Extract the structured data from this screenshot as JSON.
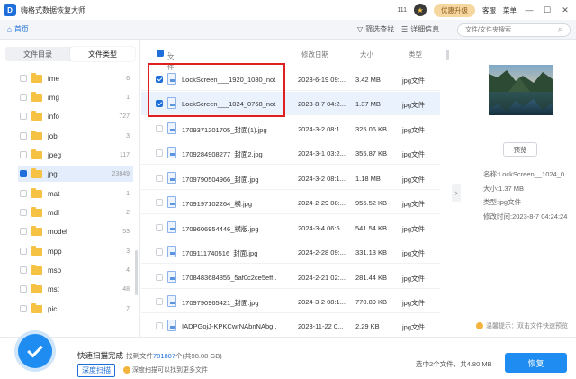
{
  "app": {
    "title": "嗨格式数据恢复大师",
    "logo": "D",
    "coins": "111",
    "vip_label": "优惠升级",
    "service": "客服",
    "menu": "菜单"
  },
  "toolbar": {
    "home": "首页",
    "filter": "筛选查找",
    "detail": "详细信息",
    "search_placeholder": "文件/文件夹搜索"
  },
  "sidebar": {
    "tabs": [
      "文件目录",
      "文件类型"
    ],
    "folders": [
      {
        "name": "ime",
        "count": "6"
      },
      {
        "name": "img",
        "count": "1"
      },
      {
        "name": "info",
        "count": "727"
      },
      {
        "name": "job",
        "count": "3"
      },
      {
        "name": "jpeg",
        "count": "117"
      },
      {
        "name": "jpg",
        "count": "23849"
      },
      {
        "name": "mat",
        "count": "1"
      },
      {
        "name": "mdl",
        "count": "2"
      },
      {
        "name": "model",
        "count": "53"
      },
      {
        "name": "mpp",
        "count": "3"
      },
      {
        "name": "msp",
        "count": "4"
      },
      {
        "name": "mst",
        "count": "48"
      },
      {
        "name": "pic",
        "count": "7"
      }
    ]
  },
  "list": {
    "headers": {
      "name": "文件名",
      "date": "修改日期",
      "size": "大小",
      "type": "类型"
    },
    "rows": [
      {
        "name": "LockScreen___1920_1080_not...",
        "date": "2023-6-19 09:...",
        "size": "3.42 MB",
        "type": "jpg文件"
      },
      {
        "name": "LockScreen___1024_0768_not...",
        "date": "2023-8-7 04:2...",
        "size": "1.37 MB",
        "type": "jpg文件"
      },
      {
        "name": "1709371201705_封面(1).jpg",
        "date": "2024-3-2 08:1...",
        "size": "325.06 KB",
        "type": "jpg文件"
      },
      {
        "name": "1709284908277_封面2.jpg",
        "date": "2024-3-1 03:2...",
        "size": "355.87 KB",
        "type": "jpg文件"
      },
      {
        "name": "1709790504966_封面.jpg",
        "date": "2024-3-2 08:1...",
        "size": "1.18 MB",
        "type": "jpg文件"
      },
      {
        "name": "1709197102264_横.jpg",
        "date": "2024-2-29 08:...",
        "size": "955.52 KB",
        "type": "jpg文件"
      },
      {
        "name": "1709606954446_横版.jpg",
        "date": "2024-3-4 06:5...",
        "size": "541.54 KB",
        "type": "jpg文件"
      },
      {
        "name": "1709111740516_封面.jpg",
        "date": "2024-2-28 09:...",
        "size": "331.13 KB",
        "type": "jpg文件"
      },
      {
        "name": "1708483684855_5af0c2ce5eff...",
        "date": "2024-2-21 02:...",
        "size": "281.44 KB",
        "type": "jpg文件"
      },
      {
        "name": "1709790965421_封面.jpg",
        "date": "2024-3-2 08:1...",
        "size": "770.89 KB",
        "type": "jpg文件"
      },
      {
        "name": "IADPGojJ-KPKCwrNAbnNAbg...",
        "date": "2023-11-22 0...",
        "size": "2.29 KB",
        "type": "jpg文件"
      }
    ]
  },
  "details": {
    "preview_button": "预览",
    "name": "名称:LockScreen__1024_0...",
    "size": "大小:1.37 MB",
    "type": "类型:jpg文件",
    "modified": "修改时间:2023-8-7 04:24:24",
    "tip": "温馨提示：双击文件快速预览"
  },
  "footer": {
    "status": "快速扫描完成",
    "found_prefix": "找到文件",
    "found_count": "781807",
    "found_suffix": "个(共98.08 GB)",
    "deep_scan": "深度扫描",
    "deep_tip": "深度扫描可以找到更多文件",
    "selected": "选中2个文件，共4.80 MB",
    "recover": "恢复"
  }
}
